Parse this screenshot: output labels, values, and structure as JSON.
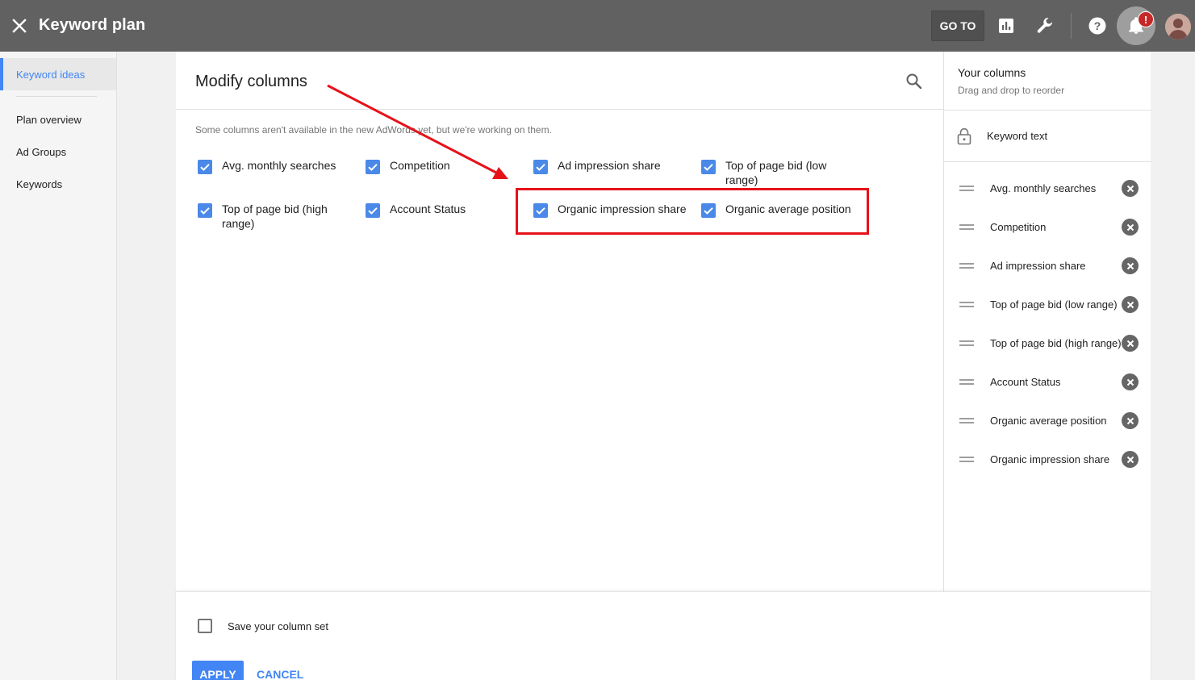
{
  "header": {
    "title": "Keyword plan",
    "goto_label": "GO TO",
    "notification_badge": "!",
    "close_icon": "close-icon",
    "reports_icon": "reports-icon",
    "tools_icon": "wrench-icon",
    "help_icon": "help-icon",
    "bell_icon": "bell-icon"
  },
  "sidebar": {
    "items": [
      {
        "label": "Keyword ideas",
        "active": true
      },
      {
        "label": "Plan overview"
      },
      {
        "label": "Ad Groups"
      },
      {
        "label": "Keywords"
      }
    ]
  },
  "modify": {
    "title": "Modify columns",
    "note": "Some columns aren't available in the new AdWords yet, but we're working on them.",
    "options": [
      {
        "label": "Avg. monthly searches",
        "checked": true
      },
      {
        "label": "Competition",
        "checked": true
      },
      {
        "label": "Ad impression share",
        "checked": true
      },
      {
        "label": "Top of page bid (low range)",
        "checked": true
      },
      {
        "label": "Top of page bid (high range)",
        "checked": true
      },
      {
        "label": "Account Status",
        "checked": true
      },
      {
        "label": "Organic impression share",
        "checked": true
      },
      {
        "label": "Organic average position",
        "checked": true
      }
    ]
  },
  "your_columns": {
    "title": "Your columns",
    "subtitle": "Drag and drop to reorder",
    "locked": "Keyword text",
    "items": [
      "Avg. monthly searches",
      "Competition",
      "Ad impression share",
      "Top of page bid (low range)",
      "Top of page bid (high range)",
      "Account Status",
      "Organic average position",
      "Organic impression share"
    ]
  },
  "footer": {
    "save_label": "Save your column set",
    "apply_label": "APPLY",
    "cancel_label": "CANCEL"
  },
  "colors": {
    "topbar": "#616161",
    "accent": "#4285f4",
    "annotation": "#e6121a"
  }
}
